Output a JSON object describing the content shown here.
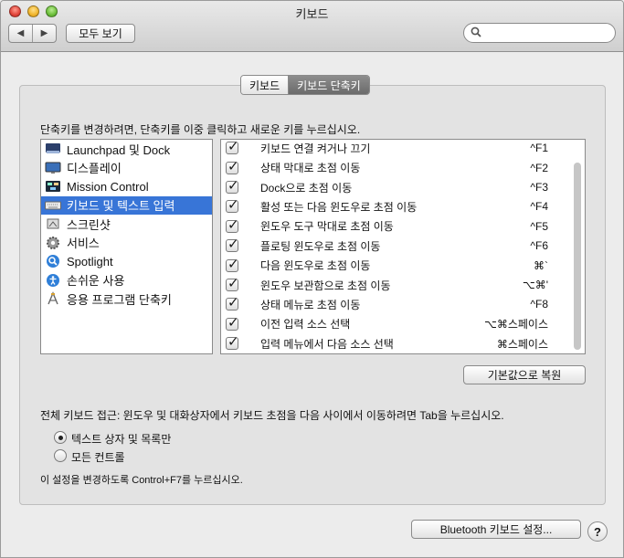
{
  "window": {
    "title": "키보드"
  },
  "toolbar": {
    "back_glyph": "◀",
    "forward_glyph": "▶",
    "show_all_label": "모두 보기",
    "search_placeholder": ""
  },
  "tabs": [
    {
      "label": "키보드",
      "active": false
    },
    {
      "label": "키보드 단축키",
      "active": true
    }
  ],
  "instruction": "단축키를 변경하려면, 단축키를 이중 클릭하고 새로운 키를 누르십시오.",
  "categories": [
    {
      "label": "Launchpad 및 Dock",
      "icon": "launchpad-icon",
      "selected": false
    },
    {
      "label": "디스플레이",
      "icon": "display-icon",
      "selected": false
    },
    {
      "label": "Mission Control",
      "icon": "mission-control-icon",
      "selected": false
    },
    {
      "label": "키보드 및 텍스트 입력",
      "icon": "keyboard-icon",
      "selected": true
    },
    {
      "label": "스크린샷",
      "icon": "screenshot-icon",
      "selected": false
    },
    {
      "label": "서비스",
      "icon": "gear-icon",
      "selected": false
    },
    {
      "label": "Spotlight",
      "icon": "spotlight-icon",
      "selected": false
    },
    {
      "label": "손쉬운 사용",
      "icon": "accessibility-icon",
      "selected": false
    },
    {
      "label": "응용 프로그램 단축키",
      "icon": "app-shortcuts-icon",
      "selected": false
    }
  ],
  "shortcuts": [
    {
      "name": "키보드 연결 켜거나 끄기",
      "keys": "^F1",
      "checked": true
    },
    {
      "name": "상태 막대로 초점 이동",
      "keys": "^F2",
      "checked": true
    },
    {
      "name": "Dock으로 초점 이동",
      "keys": "^F3",
      "checked": true
    },
    {
      "name": "활성 또는 다음 윈도우로 초점 이동",
      "keys": "^F4",
      "checked": true
    },
    {
      "name": "윈도우 도구 막대로 초점 이동",
      "keys": "^F5",
      "checked": true
    },
    {
      "name": "플로팅 윈도우로 초점 이동",
      "keys": "^F6",
      "checked": true
    },
    {
      "name": "다음 윈도우로 초점 이동",
      "keys": "⌘`",
      "checked": true
    },
    {
      "name": "윈도우 보관함으로 초점 이동",
      "keys": "⌥⌘'",
      "checked": true
    },
    {
      "name": "상태 메뉴로 초점 이동",
      "keys": "^F8",
      "checked": true
    },
    {
      "name": "이전 입력 소스 선택",
      "keys": "⌥⌘스페이스",
      "checked": true
    },
    {
      "name": "입력 메뉴에서 다음 소스 선택",
      "keys": "⌘스페이스",
      "checked": true
    }
  ],
  "restore_defaults_label": "기본값으로 복원",
  "full_keyboard_access": {
    "description": "전체 키보드 접근: 윈도우 및 대화상자에서 키보드 초점을 다음 사이에서 이동하려면 Tab을 누르십시오.",
    "options": [
      {
        "label": "텍스트 상자 및 목록만",
        "selected": true
      },
      {
        "label": "모든 컨트롤",
        "selected": false
      }
    ],
    "note": "이 설정을 변경하도록 Control+F7를 누르십시오."
  },
  "bluetooth_button_label": "Bluetooth 키보드 설정...",
  "help_label": "?"
}
